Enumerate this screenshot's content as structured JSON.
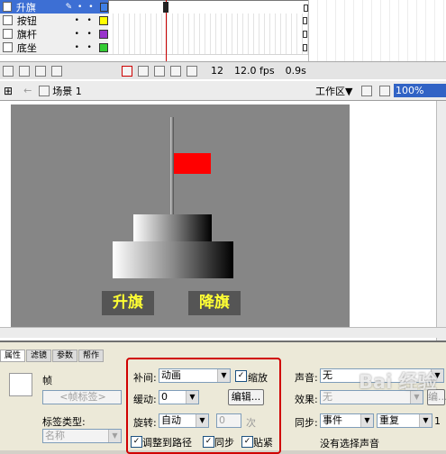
{
  "timeline": {
    "layers": [
      {
        "name": "升旗",
        "selected": true,
        "color": "#3f7fe6"
      },
      {
        "name": "按钮",
        "selected": false,
        "color": "#ffff00"
      },
      {
        "name": "旗杆",
        "selected": false,
        "color": "#9933cc"
      },
      {
        "name": "底坐",
        "selected": false,
        "color": "#33cc33"
      }
    ],
    "dot_glyph": "•",
    "pencil_glyph": "✎",
    "frame_number": "12",
    "fps": "12.0 fps",
    "elapsed": "0.9s"
  },
  "scene": {
    "back_arrow": "←",
    "scene_label": "场景 1",
    "workspace_label": "工作区▼",
    "zoom": "100%"
  },
  "stage": {
    "button_raise": "升旗",
    "button_lower": "降旗",
    "flag_color": "#ff0000",
    "button_text_color": "#ffff33"
  },
  "properties": {
    "tabs": [
      "属性",
      "滤镜",
      "参数",
      "帮作"
    ],
    "frame_label": "帧",
    "frame_name_placeholder": "<帧标签>",
    "label_type_label": "标签类型:",
    "label_type_value": "名称",
    "tween_label": "补间:",
    "tween_value": "动画",
    "scale_label": "缩放",
    "ease_label": "缓动:",
    "ease_value": "0",
    "edit_button": "编辑...",
    "rotate_label": "旋转:",
    "rotate_value": "自动",
    "rotate_count": "0",
    "rotate_unit": "次",
    "orient_label": "调整到路径",
    "sync_label": "同步",
    "snap_label": "贴紧",
    "sound_label": "声音:",
    "sound_value": "无",
    "effect_label": "效果:",
    "effect_value": "无",
    "edit_button2": "编...",
    "sync2_label": "同步:",
    "sync2_value": "事件",
    "repeat_value": "重复",
    "repeat_count": "1",
    "no_sound": "没有选择声音",
    "highlight_color": "#d00000"
  },
  "watermark": "Bai 经验"
}
